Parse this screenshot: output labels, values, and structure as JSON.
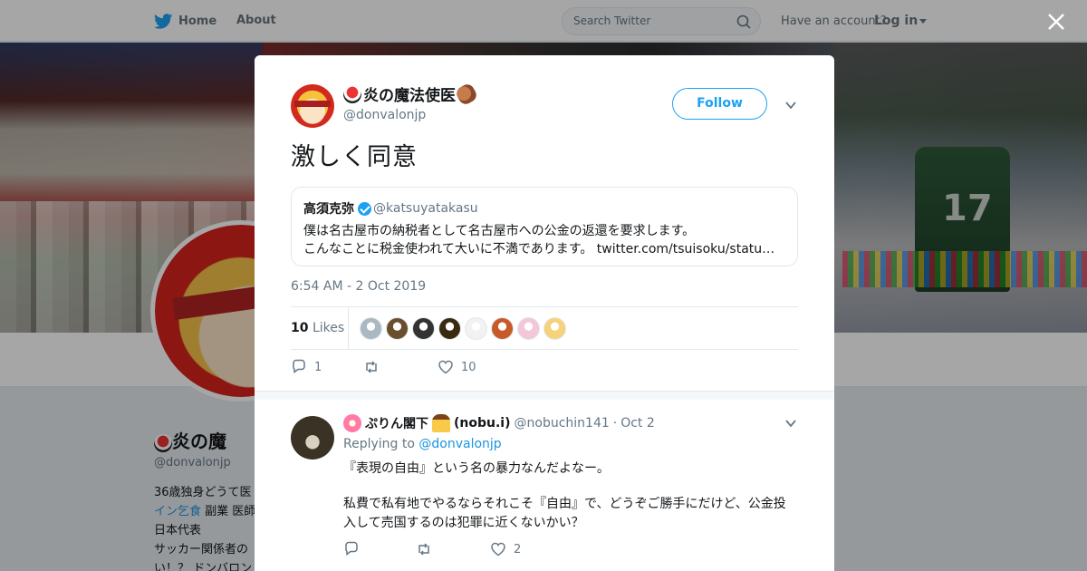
{
  "topbar": {
    "home": "Home",
    "about": "About",
    "search_placeholder": "Search Twitter",
    "have_account": "Have an account?",
    "login": "Log in"
  },
  "profile_bg": {
    "name": "炎の魔",
    "handle": "@donvalonjp",
    "bio_line1": "36歳独身どうて医",
    "bio_line2_link": "イン乞食",
    "bio_line2_rest": " 副業 医師",
    "bio_line3": "日本代表",
    "bio_line4": "サッカー関係者の",
    "bio_line5": "い！？ ドンバロン"
  },
  "banner": {
    "jersey_number": "17"
  },
  "tweet": {
    "author_name": "炎の魔法使医",
    "author_handle": "@donvalonjp",
    "follow_label": "Follow",
    "text": "激しく同意",
    "timestamp": "6:54 AM - 2 Oct 2019",
    "likes_count": "10",
    "likes_label": "Likes",
    "replies": "1",
    "retweets": "",
    "likes": "10",
    "liker_colors": [
      "#aab8c2",
      "#6b4e2e",
      "#333333",
      "#3a2a10",
      "#f2f2f2",
      "#c85a2a",
      "#f3c6d8",
      "#f6d27a"
    ]
  },
  "quoted": {
    "name": "高須克弥",
    "handle": "@katsuyatakasu",
    "line1": "僕は名古屋市の納税者として名古屋市への公金の返還を要求します。",
    "line2": "こんなことに税金使われて大いに不満であります。 twitter.com/tsuisoku/statu…"
  },
  "reply": {
    "name": "ぷりん閣下",
    "name_suffix": "(nobu.i)",
    "handle": "@nobuchin141",
    "dot": "·",
    "date": "Oct 2",
    "replying_to_label": "Replying to",
    "replying_to_handle": "@donvalonjp",
    "body1": "『表現の自由』という名の暴力なんだよなー。",
    "body2": "私費で私有地でやるならそれこそ『自由』で、どうぞご勝手にだけど、公金投入して売国するのは犯罪に近くないかい？",
    "replies": "",
    "retweets": "",
    "likes": "2"
  },
  "colors": {
    "accent": "#1da1f2",
    "link": "#1b95e0",
    "muted": "#657786"
  }
}
